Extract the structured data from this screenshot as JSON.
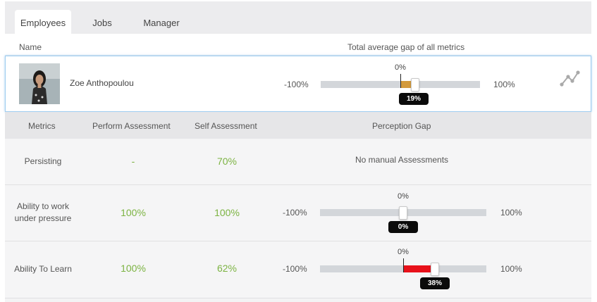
{
  "tabs": [
    {
      "label": "Employees",
      "active": true
    },
    {
      "label": "Jobs",
      "active": false
    },
    {
      "label": "Manager",
      "active": false
    }
  ],
  "columns": {
    "name": "Name",
    "total_gap": "Total average gap of all metrics"
  },
  "employee": {
    "name": "Zoe Anthopoulou",
    "gauge": {
      "min": "-100%",
      "max": "100%",
      "zero": "0%",
      "value_label": "19%",
      "value": 19,
      "fill_color": "#d39a3c"
    }
  },
  "metrics_headers": {
    "metric": "Metrics",
    "perform": "Perform Assessment",
    "self": "Self Assessment",
    "gap": "Perception Gap"
  },
  "metrics": [
    {
      "name": "Persisting",
      "perform": "-",
      "self": "70%",
      "gap_note": "No manual Assessments"
    },
    {
      "name": "Ability to work under pressure",
      "perform": "100%",
      "self": "100%",
      "gauge": {
        "min": "-100%",
        "max": "100%",
        "zero": "0%",
        "value_label": "0%",
        "value": 0,
        "fill_color": "#e02020"
      }
    },
    {
      "name": "Ability To Learn",
      "perform": "100%",
      "self": "62%",
      "gauge": {
        "min": "-100%",
        "max": "100%",
        "zero": "0%",
        "value_label": "38%",
        "value": 38,
        "fill_color": "#e8111a"
      }
    }
  ],
  "colors": {
    "positive_value": "#7cb342",
    "selected_border": "#9ecdf0"
  }
}
